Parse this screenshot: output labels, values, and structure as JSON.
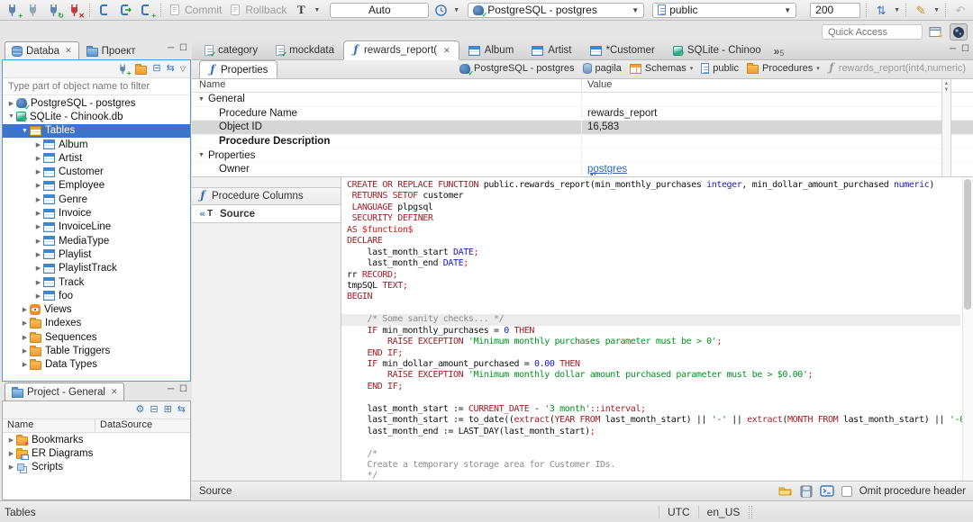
{
  "toolbar": {
    "commit_label": "Commit",
    "rollback_label": "Rollback",
    "auto_commit": "Auto",
    "connection": "PostgreSQL - postgres",
    "schema": "public",
    "fetch_size": "200",
    "quick_access_placeholder": "Quick Access"
  },
  "navigator": {
    "tabs": [
      {
        "label": "Databa",
        "icon": "dbstack",
        "active": true
      },
      {
        "label": "Проект",
        "icon": "folder-blue",
        "active": false
      }
    ],
    "filter_placeholder": "Type part of object name to filter",
    "tree": [
      {
        "label": "PostgreSQL - postgres",
        "level": 0,
        "arrow": "right",
        "icon": "postgres-db"
      },
      {
        "label": "SQLite - Chinook.db",
        "level": 0,
        "arrow": "down",
        "icon": "sqlite-db"
      },
      {
        "label": "Tables",
        "level": 1,
        "arrow": "down",
        "icon": "tables-orange",
        "selected": true
      },
      {
        "label": "Album",
        "level": 2,
        "arrow": "right",
        "icon": "table-blue"
      },
      {
        "label": "Artist",
        "level": 2,
        "arrow": "right",
        "icon": "table-blue"
      },
      {
        "label": "Customer",
        "level": 2,
        "arrow": "right",
        "icon": "table-blue"
      },
      {
        "label": "Employee",
        "level": 2,
        "arrow": "right",
        "icon": "table-blue"
      },
      {
        "label": "Genre",
        "level": 2,
        "arrow": "right",
        "icon": "table-blue"
      },
      {
        "label": "Invoice",
        "level": 2,
        "arrow": "right",
        "icon": "table-blue"
      },
      {
        "label": "InvoiceLine",
        "level": 2,
        "arrow": "right",
        "icon": "table-blue"
      },
      {
        "label": "MediaType",
        "level": 2,
        "arrow": "right",
        "icon": "table-blue"
      },
      {
        "label": "Playlist",
        "level": 2,
        "arrow": "right",
        "icon": "table-blue"
      },
      {
        "label": "PlaylistTrack",
        "level": 2,
        "arrow": "right",
        "icon": "table-blue"
      },
      {
        "label": "Track",
        "level": 2,
        "arrow": "right",
        "icon": "table-blue"
      },
      {
        "label": "foo",
        "level": 2,
        "arrow": "right",
        "icon": "table-blue"
      },
      {
        "label": "Views",
        "level": 1,
        "arrow": "right",
        "icon": "views"
      },
      {
        "label": "Indexes",
        "level": 1,
        "arrow": "right",
        "icon": "folder"
      },
      {
        "label": "Sequences",
        "level": 1,
        "arrow": "right",
        "icon": "folder"
      },
      {
        "label": "Table Triggers",
        "level": 1,
        "arrow": "right",
        "icon": "folder"
      },
      {
        "label": "Data Types",
        "level": 1,
        "arrow": "right",
        "icon": "folder"
      }
    ]
  },
  "project_panel": {
    "title": "Project - General",
    "columns": [
      "Name",
      "DataSource"
    ],
    "items": [
      {
        "label": "Bookmarks",
        "icon": "folder-bookmark"
      },
      {
        "label": "ER Diagrams",
        "icon": "folder-er"
      },
      {
        "label": "Scripts",
        "icon": "scripts"
      }
    ]
  },
  "editor": {
    "tabs": [
      {
        "label": "category",
        "icon": "script"
      },
      {
        "label": "mockdata",
        "icon": "script"
      },
      {
        "label": "rewards_report(",
        "icon": "function",
        "active": true
      },
      {
        "label": "Album",
        "icon": "table-blue"
      },
      {
        "label": "Artist",
        "icon": "table-blue"
      },
      {
        "label": "*Customer",
        "icon": "table-blue"
      },
      {
        "label": "SQLite - Chinoo",
        "icon": "sqlite-db"
      }
    ],
    "overflow_count": "5",
    "properties_tab": "Properties",
    "breadcrumb": [
      {
        "label": "PostgreSQL - postgres",
        "icon": "postgres-db"
      },
      {
        "label": "pagila",
        "icon": "dbcyl"
      },
      {
        "label": "Schemas",
        "icon": "schemas",
        "dropdown": true
      },
      {
        "label": "public",
        "icon": "doc-blue"
      },
      {
        "label": "Procedures",
        "icon": "folder",
        "dropdown": true
      },
      {
        "label": "rewards_report(int4,numeric)",
        "icon": "function",
        "muted": true
      }
    ],
    "grid": {
      "columns": [
        "Name",
        "Value"
      ],
      "rows": [
        {
          "name": "General",
          "value": "",
          "group": true
        },
        {
          "name": "Procedure Name",
          "value": "rewards_report"
        },
        {
          "name": "Object ID",
          "value": "16,583",
          "selected": true
        },
        {
          "name": "Procedure Description",
          "value": "",
          "bold": true
        },
        {
          "name": "Properties",
          "value": "",
          "group": true
        },
        {
          "name": "Owner",
          "value": "postgres",
          "link": true
        }
      ]
    },
    "side_tabs": [
      {
        "label": "Procedure Columns",
        "icon": "function"
      },
      {
        "label": "Source",
        "icon": "source",
        "active": true
      }
    ],
    "code_lines": [
      {
        "s": [
          [
            "kw",
            "CREATE OR REPLACE FUNCTION"
          ],
          [
            "pl",
            " public.rewards_report(min_monthly_purchases "
          ],
          [
            "ty",
            "integer"
          ],
          [
            "pl",
            ", min_dollar_amount_purchased "
          ],
          [
            "ty",
            "numeric"
          ],
          [
            "pl",
            ")"
          ]
        ]
      },
      {
        "s": [
          [
            "pl",
            " "
          ],
          [
            "kw",
            "RETURNS SETOF"
          ],
          [
            "pl",
            " customer"
          ]
        ]
      },
      {
        "s": [
          [
            "pl",
            " "
          ],
          [
            "kw",
            "LANGUAGE"
          ],
          [
            "pl",
            " plpgsql"
          ]
        ]
      },
      {
        "s": [
          [
            "pl",
            " "
          ],
          [
            "kw",
            "SECURITY DEFINER"
          ]
        ]
      },
      {
        "s": [
          [
            "kw",
            "AS"
          ],
          [
            "pl",
            " "
          ],
          [
            "de",
            "$function$"
          ]
        ]
      },
      {
        "s": [
          [
            "kw",
            "DECLARE"
          ]
        ]
      },
      {
        "s": [
          [
            "pl",
            "    last_month_start "
          ],
          [
            "ty",
            "DATE"
          ],
          [
            "de",
            ";"
          ]
        ]
      },
      {
        "s": [
          [
            "pl",
            "    last_month_end "
          ],
          [
            "ty",
            "DATE"
          ],
          [
            "de",
            ";"
          ]
        ]
      },
      {
        "s": [
          [
            "pl",
            "rr "
          ],
          [
            "kw",
            "RECORD"
          ],
          [
            "de",
            ";"
          ]
        ]
      },
      {
        "s": [
          [
            "pl",
            "tmpSQL "
          ],
          [
            "kw",
            "TEXT"
          ],
          [
            "de",
            ";"
          ]
        ]
      },
      {
        "s": [
          [
            "kw",
            "BEGIN"
          ]
        ]
      },
      {
        "s": []
      },
      {
        "hl": true,
        "s": [
          [
            "pl",
            "    "
          ],
          [
            "co",
            "/* Some sanity checks... */"
          ]
        ]
      },
      {
        "s": [
          [
            "pl",
            "    "
          ],
          [
            "kw",
            "IF"
          ],
          [
            "pl",
            " min_monthly_purchases = "
          ],
          [
            "ty",
            "0"
          ],
          [
            "pl",
            " "
          ],
          [
            "kw",
            "THEN"
          ]
        ]
      },
      {
        "s": [
          [
            "pl",
            "        "
          ],
          [
            "kw",
            "RAISE EXCEPTION"
          ],
          [
            "pl",
            " "
          ],
          [
            "st",
            "'Minimum monthly purchases parameter must be > 0'"
          ],
          [
            "de",
            ";"
          ]
        ]
      },
      {
        "s": [
          [
            "pl",
            "    "
          ],
          [
            "kw",
            "END IF"
          ],
          [
            "de",
            ";"
          ]
        ]
      },
      {
        "s": [
          [
            "pl",
            "    "
          ],
          [
            "kw",
            "IF"
          ],
          [
            "pl",
            " min_dollar_amount_purchased = "
          ],
          [
            "ty",
            "0.00"
          ],
          [
            "pl",
            " "
          ],
          [
            "kw",
            "THEN"
          ]
        ]
      },
      {
        "s": [
          [
            "pl",
            "        "
          ],
          [
            "kw",
            "RAISE EXCEPTION"
          ],
          [
            "pl",
            " "
          ],
          [
            "st",
            "'Minimum monthly dollar amount purchased parameter must be > $0.00'"
          ],
          [
            "de",
            ";"
          ]
        ]
      },
      {
        "s": [
          [
            "pl",
            "    "
          ],
          [
            "kw",
            "END IF"
          ],
          [
            "de",
            ";"
          ]
        ]
      },
      {
        "s": []
      },
      {
        "s": [
          [
            "pl",
            "    last_month_start := "
          ],
          [
            "kw",
            "CURRENT_DATE"
          ],
          [
            "pl",
            " - "
          ],
          [
            "st",
            "'3 month'"
          ],
          [
            "kw",
            "::interval"
          ],
          [
            "de",
            ";"
          ]
        ]
      },
      {
        "s": [
          [
            "pl",
            "    last_month_start := to_date(("
          ],
          [
            "kw",
            "extract"
          ],
          [
            "pl",
            "("
          ],
          [
            "kw",
            "YEAR FROM"
          ],
          [
            "pl",
            " last_month_start) || "
          ],
          [
            "st",
            "'-'"
          ],
          [
            "pl",
            " || "
          ],
          [
            "kw",
            "extract"
          ],
          [
            "pl",
            "("
          ],
          [
            "kw",
            "MONTH FROM"
          ],
          [
            "pl",
            " last_month_start) || "
          ],
          [
            "st",
            "'-0"
          ]
        ]
      },
      {
        "s": [
          [
            "pl",
            "    last_month_end := LAST_DAY(last_month_start)"
          ],
          [
            "de",
            ";"
          ]
        ]
      },
      {
        "s": []
      },
      {
        "s": [
          [
            "pl",
            "    "
          ],
          [
            "co",
            "/*"
          ]
        ]
      },
      {
        "s": [
          [
            "pl",
            "    "
          ],
          [
            "co",
            "Create a temporary storage area for Customer IDs."
          ]
        ]
      },
      {
        "s": [
          [
            "pl",
            "    "
          ],
          [
            "co",
            "*/"
          ]
        ]
      }
    ],
    "footer": {
      "label": "Source",
      "omit_checkbox_label": "Omit procedure header"
    }
  },
  "statusbar": {
    "selection": "Tables",
    "timezone": "UTC",
    "locale": "en_US"
  },
  "colors": {
    "selection": "#3d76c9",
    "focus_border": "#569bd8",
    "keyword": "#a02028",
    "string": "#00931f",
    "number_type": "#1a1ac8",
    "comment": "#8b8b8b",
    "delimiter": "#e01010",
    "link": "#2a66c8",
    "folder_orange": "#ef9c2f",
    "table_blue": "#3f87cc"
  }
}
